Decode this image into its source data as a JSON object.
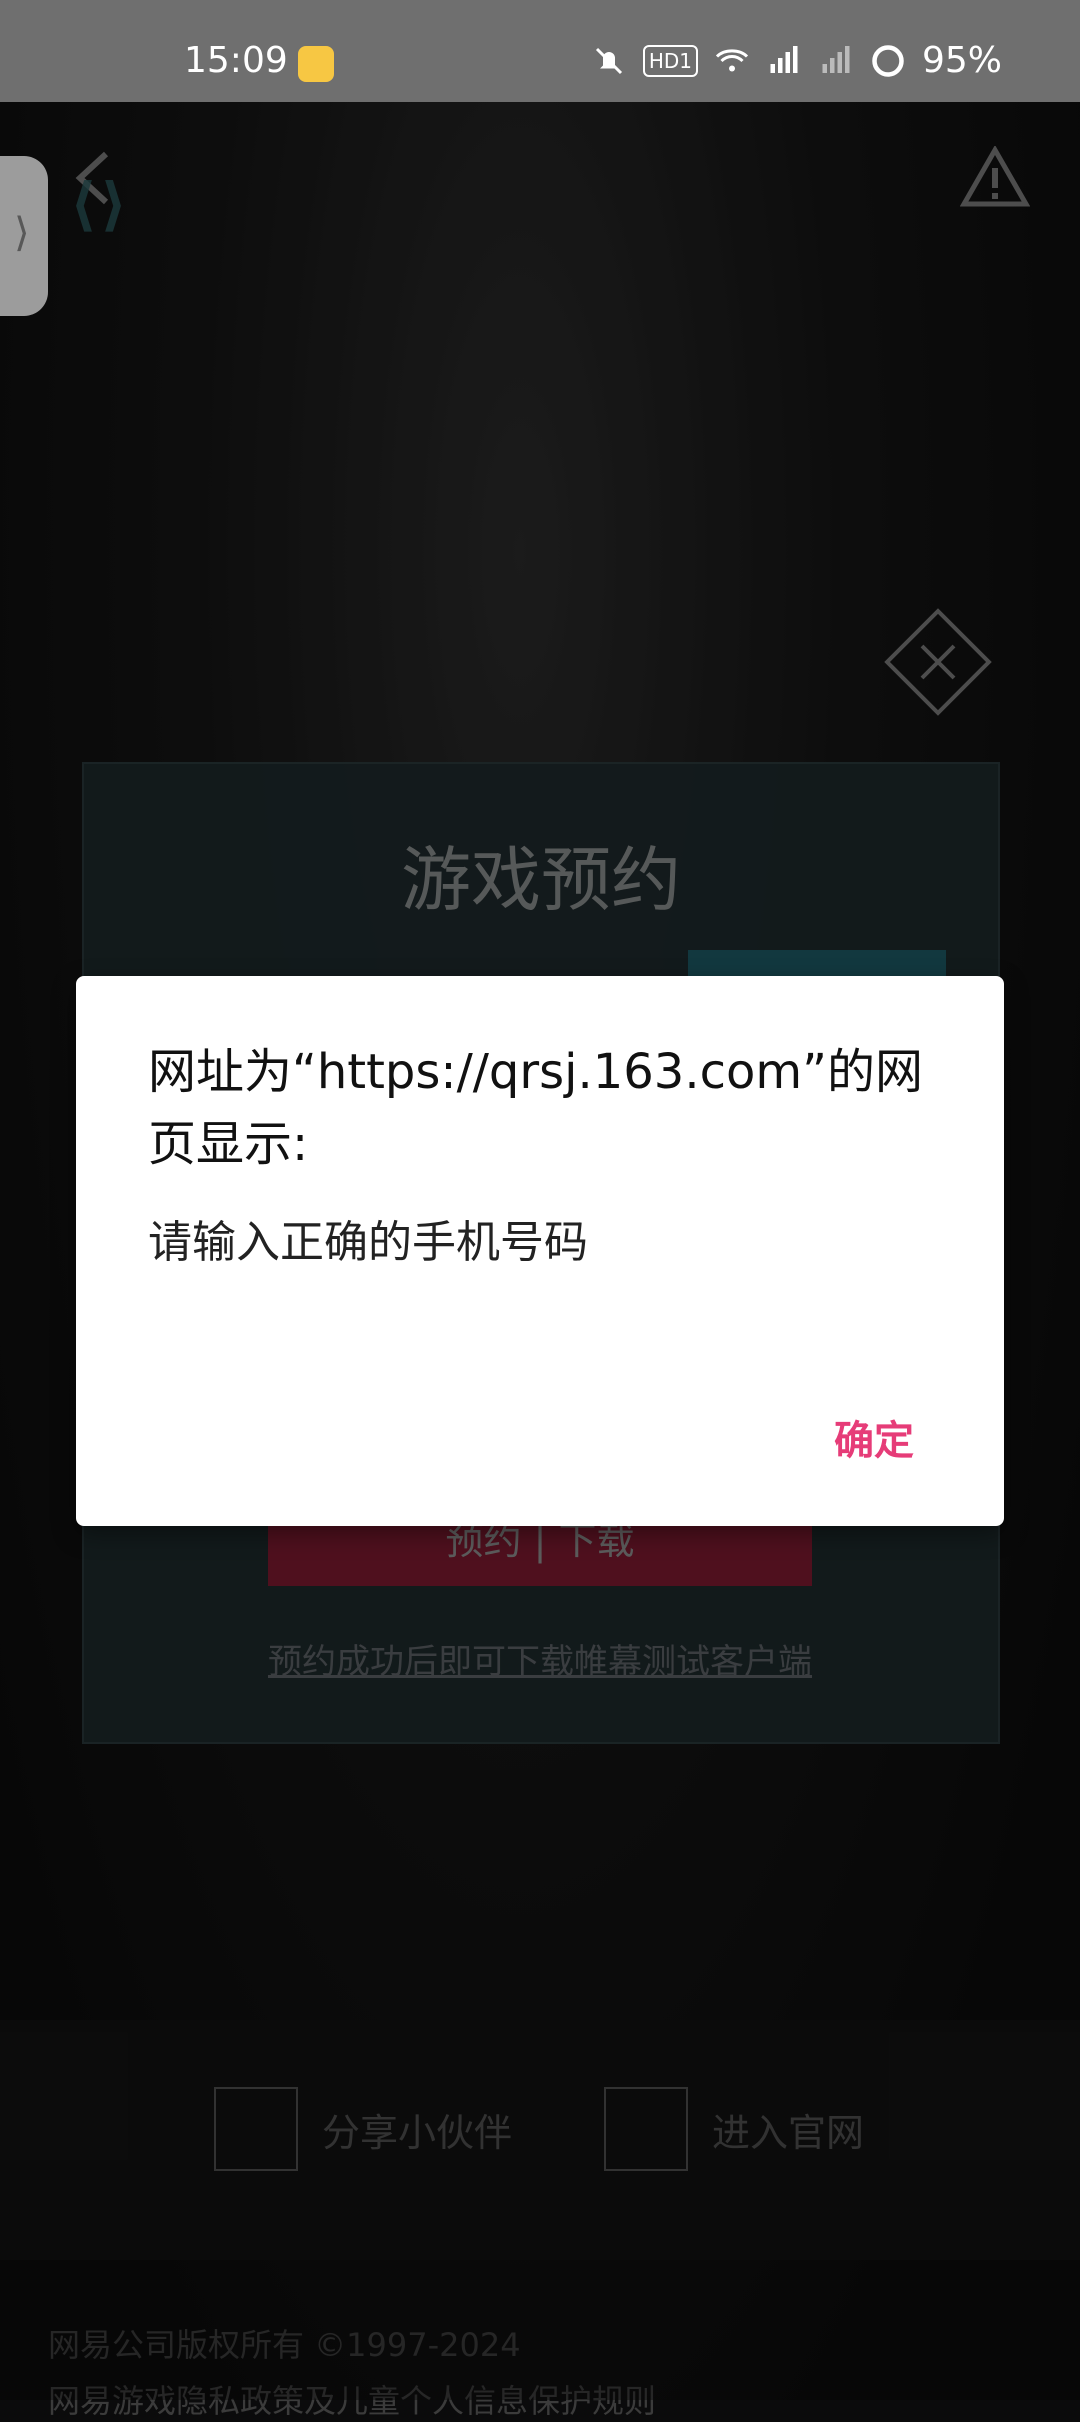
{
  "status_bar": {
    "time": "15:09",
    "battery": "95%",
    "icons": [
      "app-notif-icon",
      "mute-icon",
      "hd-icon",
      "wifi-icon",
      "signal-5g-icon",
      "signal-icon",
      "battery-ring-icon"
    ],
    "hd_label": "HD1"
  },
  "page": {
    "reserve_title": "游戏预约",
    "reserve_button": "预约 | 下载",
    "reserve_caption": "预约成功后即可下载帷幕测试客户端",
    "share_label": "分享小伙伴",
    "official_label": "进入官网",
    "copyright": "网易公司版权所有 ©1997-2024",
    "policy": "网易游戏隐私政策及儿童个人信息保护规则"
  },
  "dialog": {
    "title": "网址为“https://qrsj.163.com”的网页显示:",
    "message": "请输入正确的手机号码",
    "ok": "确定"
  },
  "colors": {
    "status_bar": "#6f6f6f",
    "dialog_accent": "#e63c78",
    "panel": "#1e2a2c"
  }
}
